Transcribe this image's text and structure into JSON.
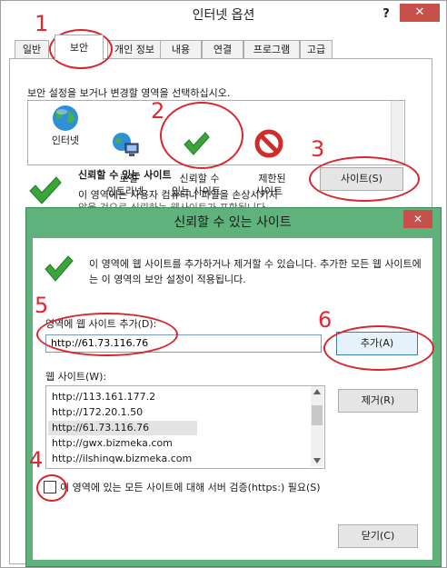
{
  "outer_window": {
    "title": "인터넷 옵션",
    "help_glyph": "?",
    "close_glyph": "✕",
    "tabs": [
      "일반",
      "보안",
      "개인 정보",
      "내용",
      "연결",
      "프로그램",
      "고급"
    ],
    "active_tab": "보안"
  },
  "security": {
    "instruction": "보안 설정을 보거나 변경할 영역을 선택하십시오.",
    "zones": [
      {
        "label": "인터넷",
        "icon": "globe-icon"
      },
      {
        "label": "로컬\n인트라넷",
        "icon": "intranet-icon"
      },
      {
        "label": "신뢰할 수\n있는 사이트",
        "icon": "checkmark-icon"
      },
      {
        "label": "제한된\n사이트",
        "icon": "restricted-icon"
      }
    ],
    "zone_title": "신뢰할 수 있는 사이트",
    "zone_desc_line1": "이 영역에는 사용자 컴퓨터나 파일을 손상시키지",
    "zone_desc_line2": "않을 것으로 신뢰하는 웹사이트가 포함됩니다",
    "sites_button": "사이트(S)"
  },
  "trusted_dialog": {
    "title": "신뢰할 수 있는 사이트",
    "close_glyph": "✕",
    "info_text": "이 영역에 웹 사이트를 추가하거나 제거할 수 있습니다. 추가한 모든 웹 사이트에는 이 영역의 보안 설정이 적용됩니다.",
    "add_label": "영역에 웹 사이트 추가(D):",
    "url_value": "http://61.73.116.76",
    "add_button": "추가(A)",
    "list_label": "웹 사이트(W):",
    "sites": [
      "http://113.161.177.2",
      "http://172.20.1.50",
      "http://61.73.116.76",
      "http://gwx.bizmeka.com",
      "http://ilshinqw.bizmeka.com"
    ],
    "selected_site": "http://61.73.116.76",
    "remove_button": "제거(R)",
    "https_checkbox_label": "이 영역에 있는 모든 사이트에 대해 서버 검증(https:) 필요(S)",
    "https_checked": false,
    "close_button": "닫기(C)"
  },
  "annotations": [
    "1",
    "2",
    "3",
    "4",
    "5",
    "6"
  ],
  "colors": {
    "annotation_red": "#d9252e",
    "dialog_frame_green": "#5fb27c",
    "close_red": "#c7504a",
    "selection_gray": "#e3e3e3"
  }
}
